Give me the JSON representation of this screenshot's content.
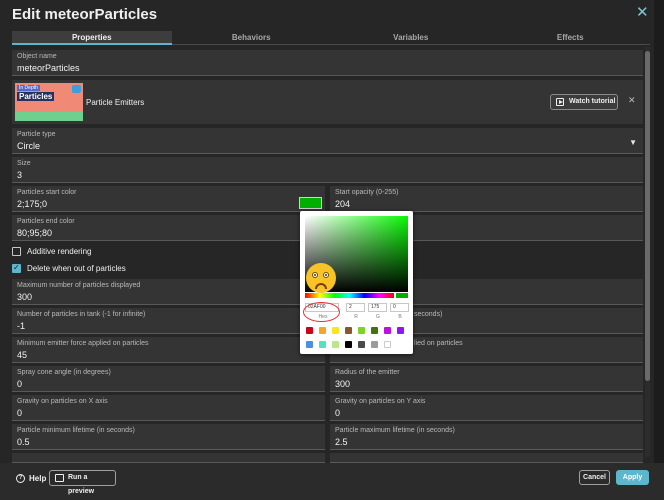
{
  "dialog": {
    "title": "Edit meteorParticles",
    "close_icon": "close-icon"
  },
  "tabs": [
    {
      "label": "Properties",
      "active": true
    },
    {
      "label": "Behaviors",
      "active": false
    },
    {
      "label": "Variables",
      "active": false
    },
    {
      "label": "Effects",
      "active": false
    }
  ],
  "object_name": {
    "label": "Object name",
    "value": "meteorParticles"
  },
  "tutorial_banner": {
    "thumbnail_tag": "In Depth",
    "thumbnail_title": "Particles",
    "title": "Particle Emitters",
    "button_label": "Watch tutorial"
  },
  "fields": {
    "particle_type": {
      "label": "Particle type",
      "value": "Circle"
    },
    "size": {
      "label": "Size",
      "value": "3"
    },
    "start_color": {
      "label": "Particles start color",
      "value": "2;175;0"
    },
    "start_opacity": {
      "label": "Start opacity (0-255)",
      "value": "204"
    },
    "end_color": {
      "label": "Particles end color",
      "value": "80;95;80"
    },
    "max_particles": {
      "label": "Maximum number of particles displayed",
      "value": "300"
    },
    "tank": {
      "label": "Number of particles in tank (-1 for infinite)",
      "value": "-1"
    },
    "tank_right_partial": {
      "label": "seconds)",
      "value": ""
    },
    "min_force": {
      "label": "Minimum emitter force applied on particles",
      "value": "45"
    },
    "max_force_partial": {
      "label": "lied on particles",
      "value": ""
    },
    "spray_cone": {
      "label": "Spray cone angle (in degrees)",
      "value": "0"
    },
    "radius": {
      "label": "Radius of the emitter",
      "value": "300"
    },
    "gravity_x": {
      "label": "Gravity on particles on X axis",
      "value": "0"
    },
    "gravity_y": {
      "label": "Gravity on particles on Y axis",
      "value": "0"
    },
    "min_lifetime": {
      "label": "Particle minimum lifetime (in seconds)",
      "value": "0.5"
    },
    "max_lifetime": {
      "label": "Particle maximum lifetime (in seconds)",
      "value": "2.5"
    }
  },
  "checkboxes": {
    "additive": {
      "label": "Additive rendering",
      "checked": false
    },
    "delete_out": {
      "label": "Delete when out of particles",
      "checked": true
    }
  },
  "color_picker": {
    "hex": "02AF00",
    "r": "2",
    "g": "175",
    "b": "0",
    "hex_label": "Hex",
    "r_label": "R",
    "g_label": "G",
    "b_label": "B",
    "current_color": "#02af00",
    "presets": [
      "#d0021b",
      "#f5a623",
      "#f8e71c",
      "#8b572a",
      "#7ed321",
      "#417505",
      "#bd10e0",
      "#9013fe",
      "#4a90e2",
      "#50e3c2",
      "#b8e986",
      "#000000",
      "#4a4a4a",
      "#9b9b9b",
      "#ffffff"
    ]
  },
  "footer": {
    "help_label": "Help",
    "preview_label": "Run a preview",
    "cancel_label": "Cancel",
    "apply_label": "Apply"
  },
  "colors": {
    "accent": "#5eb6cc",
    "background": "#262626",
    "field": "#343434"
  }
}
